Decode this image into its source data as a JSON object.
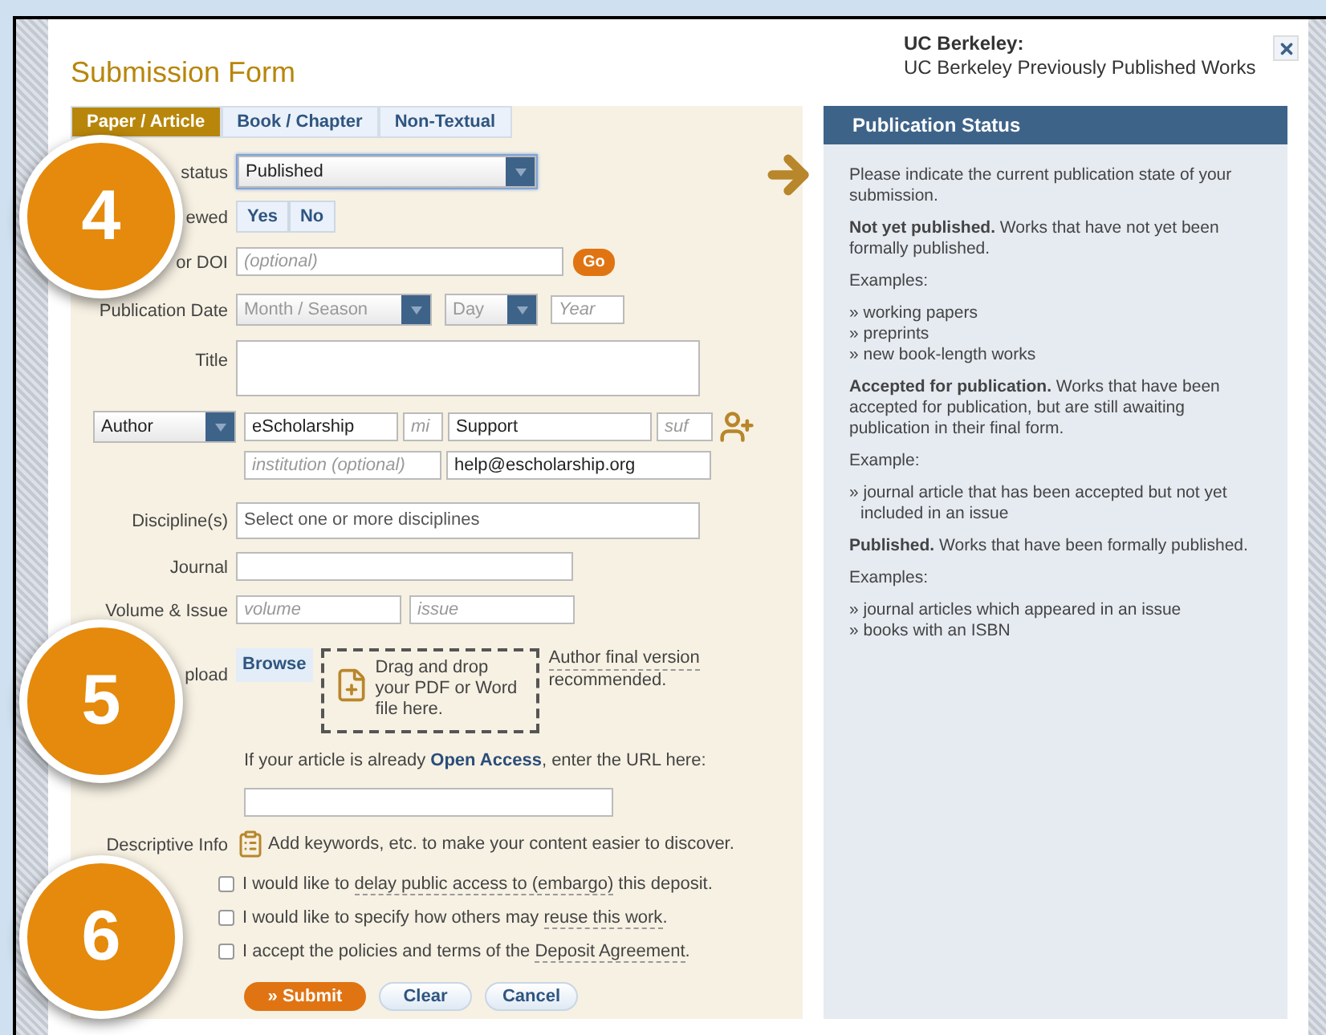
{
  "header": {
    "title": "Submission Form",
    "unit": "UC Berkeley:",
    "series": "UC Berkeley Previously Published Works"
  },
  "tabs": [
    {
      "label": "Paper / Article",
      "selected": true
    },
    {
      "label": "Book / Chapter",
      "selected": false
    },
    {
      "label": "Non-Textual",
      "selected": false
    }
  ],
  "form": {
    "status": {
      "label": "status",
      "value": "Published"
    },
    "peer_review": {
      "label": "ewed",
      "options": [
        {
          "label": "Yes",
          "selected": false
        },
        {
          "label": "No",
          "selected": false
        }
      ]
    },
    "doi": {
      "label": "or DOI",
      "placeholder": "(optional)",
      "button": "Go"
    },
    "date": {
      "label": "Publication Date",
      "month": "Month / Season",
      "day": "Day",
      "year_placeholder": "Year"
    },
    "title": {
      "label": "Title"
    },
    "author": {
      "role": "Author",
      "first": "eScholarship",
      "mi_placeholder": "mi",
      "last": "Support",
      "suffix_placeholder": "suf",
      "institution_placeholder": "institution (optional)",
      "email": "help@escholarship.org"
    },
    "disciplines": {
      "label": "Discipline(s)",
      "placeholder": "Select one or more disciplines"
    },
    "journal": {
      "label": "Journal"
    },
    "volume_issue": {
      "label": "Volume & Issue",
      "volume_placeholder": "volume",
      "issue_placeholder": "issue"
    },
    "upload": {
      "label": "pload",
      "button": "Browse",
      "drop_text": "Drag and drop your PDF or Word file here.",
      "note_link": "Author final version",
      "note_rest": "recommended."
    },
    "open_access": {
      "text": "If your article is already **Open Access**, enter the URL here:"
    },
    "descriptive": {
      "label": "Descriptive Info",
      "text": "Add keywords, etc. to make your content easier to discover."
    },
    "agreements": [
      {
        "before": "I would like to ",
        "link": "delay public access to (embargo)",
        "after": " this deposit.",
        "checked": false
      },
      {
        "before": "I would like to specify how others may ",
        "link": "reuse this work",
        "after": ".",
        "checked": false
      },
      {
        "before": "I accept the policies and terms of the ",
        "link": "Deposit Agreement",
        "after": ".",
        "checked": false
      }
    ],
    "buttons": [
      {
        "label": "» Submit",
        "kind": "primary"
      },
      {
        "label": "Clear",
        "kind": "secondary"
      },
      {
        "label": "Cancel",
        "kind": "secondary"
      }
    ]
  },
  "steps": [
    "4",
    "5",
    "6"
  ],
  "help": {
    "title": "Publication Status",
    "blocks": [
      {
        "kind": "text",
        "text": "Please indicate the current publication state of your submission."
      },
      {
        "kind": "text",
        "text": "**Not yet published.** Works that have not yet been formally published."
      },
      {
        "kind": "text",
        "text": "Examples:"
      },
      {
        "kind": "list",
        "items": [
          "» working papers",
          "» preprints",
          "» new book-length works"
        ]
      },
      {
        "kind": "text",
        "text": "**Accepted for publication.** Works that have been accepted for publication, but are still awaiting publication in their final form."
      },
      {
        "kind": "text",
        "text": "Example:"
      },
      {
        "kind": "list",
        "items": [
          "» journal article that has been accepted but not yet included in an issue"
        ]
      },
      {
        "kind": "text",
        "text": "**Published.** Works that have been formally published."
      },
      {
        "kind": "text",
        "text": "Examples:"
      },
      {
        "kind": "list",
        "items": [
          "» journal articles which appeared in an issue",
          "» books with an ISBN"
        ]
      }
    ]
  }
}
